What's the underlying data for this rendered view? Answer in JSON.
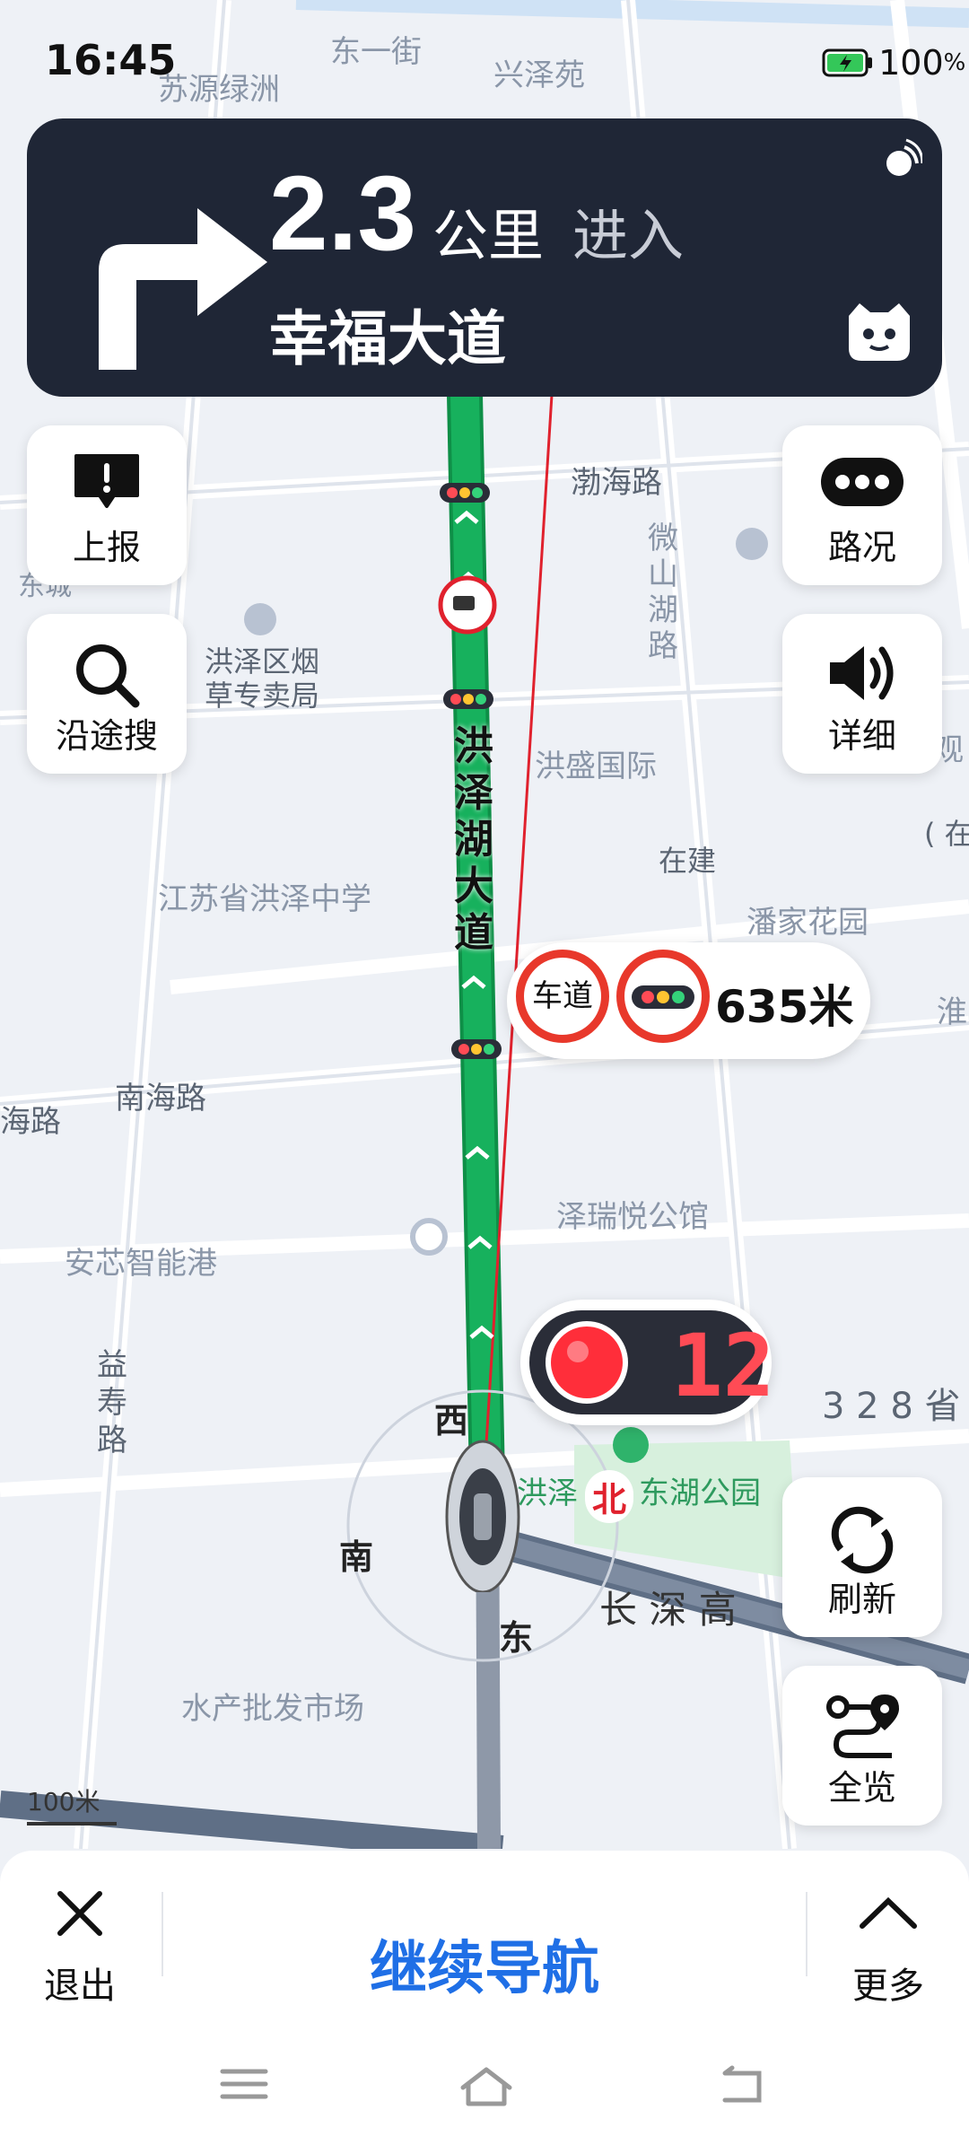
{
  "status_bar": {
    "time": "16:45",
    "battery": "100",
    "battery_unit": "%"
  },
  "banner": {
    "distance": "2.3",
    "unit": "公里",
    "action": "进入",
    "road": "幸福大道"
  },
  "left_buttons": [
    {
      "label": "上报"
    },
    {
      "label": "沿途搜"
    }
  ],
  "right_buttons": [
    {
      "label": "路况"
    },
    {
      "label": "详细"
    },
    {
      "label": "刷新"
    },
    {
      "label": "全览"
    }
  ],
  "route": {
    "road_label": [
      "洪",
      "泽",
      "湖",
      "大",
      "道"
    ]
  },
  "lane_bubble": {
    "lane_text": "车道",
    "distance": "635米"
  },
  "signal": {
    "countdown": "12",
    "light_color": "#ff2e3a"
  },
  "compass": {
    "west": "西",
    "south": "南",
    "east": "东",
    "north": "北"
  },
  "scale": {
    "label": "100米"
  },
  "map_labels": {
    "dongyijie": "东一街",
    "xingzeyuan": "兴泽苑",
    "suyuanlvzhou": "苏源绿洲",
    "bohailu": "渤海路",
    "weishanhulu": [
      "微",
      "山",
      "湖",
      "路"
    ],
    "yancao": "洪泽区烟",
    "yancao2": "草专卖局",
    "hongshengguoji": "洪盛国际",
    "zaijian": "在建",
    "zaijian2": "( 在",
    "panjiahuayuan": "潘家花园",
    "jiangsuzhongxue": "江苏省洪泽中学",
    "nanhailu": "南海路",
    "hailu": "海路",
    "zeruiyue": "泽瑞悦公馆",
    "anxin": "安芯智能港",
    "yishoulu": [
      "益",
      "寿",
      "路"
    ],
    "hongzegongyuan": "洪泽",
    "donghugongyuan": "东湖公园",
    "changshen": "长 深 高",
    "sheng328": "3 2 8 省",
    "shuichan": "水产批发市场",
    "dongcheng": "东城",
    "guan": "观",
    "huai": "淮"
  },
  "bottom_bar": {
    "exit_label": "退出",
    "continue_label": "继续导航",
    "more_label": "更多"
  },
  "colors": {
    "route_green": "#17b15d",
    "accent_blue": "#1f6fe6",
    "banner_bg": "#1f2636"
  }
}
